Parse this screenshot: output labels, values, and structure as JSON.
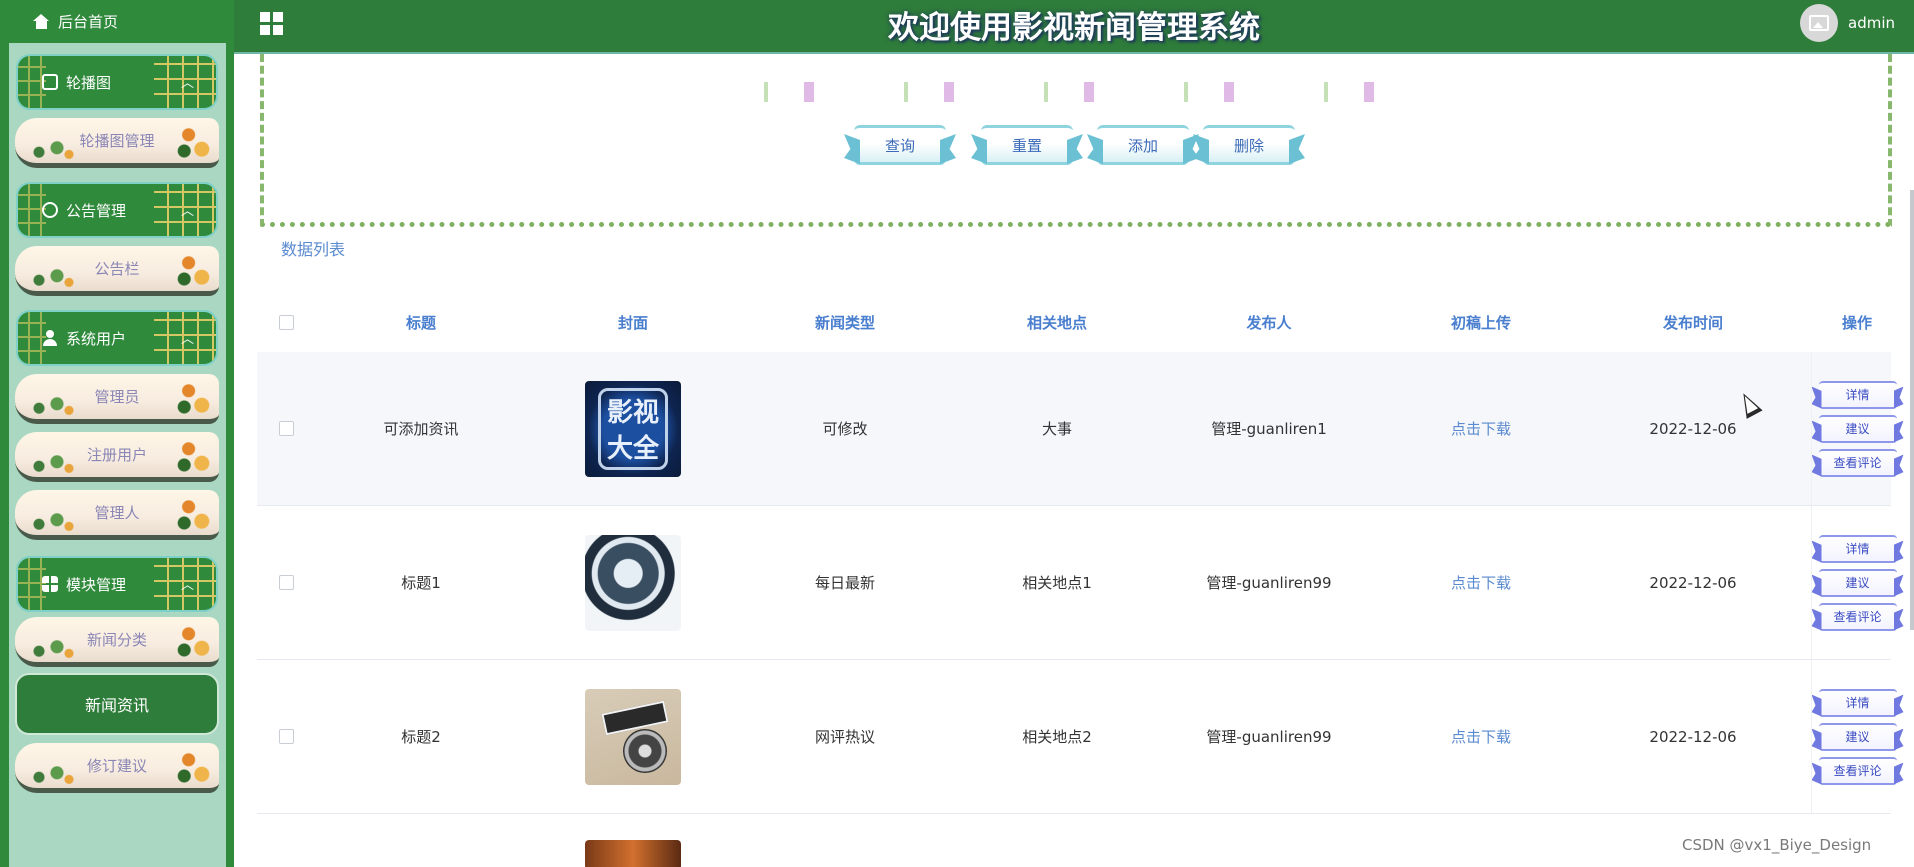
{
  "sidebar": {
    "home_label": "后台首页",
    "groups": [
      {
        "label": "轮播图",
        "items": [
          "轮播图管理"
        ]
      },
      {
        "label": "公告管理",
        "items": [
          "公告栏"
        ]
      },
      {
        "label": "系统用户",
        "items": [
          "管理员",
          "注册用户",
          "管理人"
        ]
      },
      {
        "label": "模块管理",
        "items": [
          "新闻分类",
          "新闻资讯",
          "修订建议"
        ]
      }
    ],
    "active_item": "新闻资讯"
  },
  "header": {
    "title": "欢迎使用影视新闻管理系统",
    "username": "admin"
  },
  "search": {
    "buttons": {
      "query": "查询",
      "reset": "重置",
      "add": "添加",
      "delete": "删除"
    }
  },
  "list_label": "数据列表",
  "table": {
    "columns": [
      "标题",
      "封面",
      "新闻类型",
      "相关地点",
      "发布人",
      "初稿上传",
      "发布时间",
      "操作"
    ],
    "rows": [
      {
        "title": "可添加资讯",
        "cover_text": "影视大全",
        "type": "可修改",
        "place": "大事",
        "publisher": "管理-guanliren1",
        "upload": "点击下载",
        "date": "2022-12-06"
      },
      {
        "title": "标题1",
        "type": "每日最新",
        "place": "相关地点1",
        "publisher": "管理-guanliren99",
        "upload": "点击下载",
        "date": "2022-12-06"
      },
      {
        "title": "标题2",
        "type": "网评热议",
        "place": "相关地点2",
        "publisher": "管理-guanliren99",
        "upload": "点击下载",
        "date": "2022-12-06"
      }
    ],
    "ops": {
      "detail": "详情",
      "suggest": "建议",
      "comments": "查看评论"
    }
  },
  "watermark": "CSDN @vx1_Biye_Design",
  "colors": {
    "primary_green": "#2f7d3a",
    "accent_blue": "#4a7fcf",
    "sidebar_bg": "#a9d7c1"
  }
}
